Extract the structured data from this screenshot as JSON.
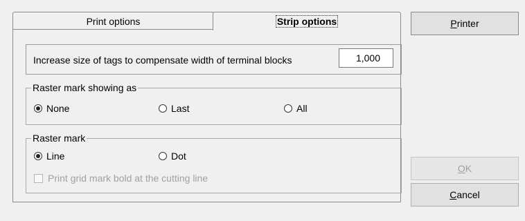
{
  "tabs": {
    "print_options": "Print options",
    "strip_options": "Strip options"
  },
  "size_field": {
    "label": "Increase size of tags to compensate width of terminal blocks",
    "value": "1,000"
  },
  "raster_showing": {
    "legend": "Raster mark showing as",
    "options": [
      "None",
      "Last",
      "All"
    ],
    "selected": "None"
  },
  "raster_mark": {
    "legend": "Raster mark",
    "options": [
      "Line",
      "Dot"
    ],
    "selected": "Line",
    "checkbox_label": "Print grid mark bold at the cutting line"
  },
  "buttons": {
    "printer": {
      "mnemonic": "P",
      "rest": "rinter"
    },
    "ok": {
      "mnemonic": "O",
      "rest": "K"
    },
    "cancel": {
      "mnemonic": "C",
      "rest": "ancel"
    }
  }
}
